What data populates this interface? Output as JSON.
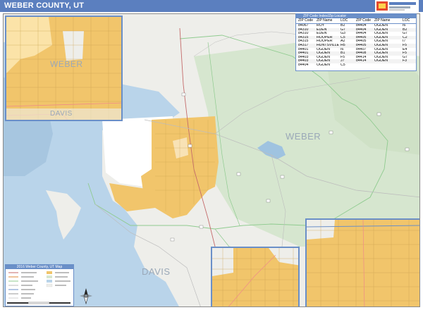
{
  "title": "WEBER COUNTY, UT",
  "logo": {
    "brand": "Market Maps",
    "icon": "market-maps-logo"
  },
  "map": {
    "labels": {
      "county_main": "WEBER",
      "davis_main": "DAVIS",
      "weber_inset": "WEBER",
      "davis_inset": "DAVIS"
    },
    "colors": {
      "water": "#b9d4ea",
      "lake_dark": "#a7c6e0",
      "land": "#eeeeea",
      "urban": "#f1c56b",
      "forest": "#d6e6cf",
      "boundary": "#8fcb8f",
      "road": "#d0d0d0",
      "frame": "#6a8fc8"
    }
  },
  "zip_table": {
    "title": "ZIP Code Index/Zip Locator",
    "headers": [
      "ZIP Code",
      "ZIP Name",
      "LOC",
      "ZIP Code",
      "ZIP Name",
      "LOC"
    ],
    "left_rows": [
      [
        "84067",
        "ROY",
        "B2"
      ],
      [
        "84310",
        "EDEN",
        "G7"
      ],
      [
        "84310",
        "EDEN",
        "G3"
      ],
      [
        "84315",
        "HOOPER",
        "C5"
      ],
      [
        "84315",
        "HOOPER",
        "A2"
      ],
      [
        "84317",
        "HUNTSVILLE",
        "H5"
      ],
      [
        "84401",
        "OGDEN",
        "I6"
      ],
      [
        "84401",
        "OGDEN",
        "B1"
      ],
      [
        "84403",
        "OGDEN",
        "F5"
      ],
      [
        "84403",
        "OGDEN",
        "J7"
      ],
      [
        "84404",
        "OGDEN",
        "C5"
      ]
    ],
    "right_rows": [
      [
        "84404",
        "OGDEN",
        "I6"
      ],
      [
        "84404",
        "OGDEN",
        "B2"
      ],
      [
        "84404",
        "OGDEN",
        "G7"
      ],
      [
        "84405",
        "OGDEN",
        "C2"
      ],
      [
        "84405",
        "OGDEN",
        "I7"
      ],
      [
        "84405",
        "OGDEN",
        "F5"
      ],
      [
        "84407",
        "OGDEN",
        "E4"
      ],
      [
        "84408",
        "OGDEN",
        "F5"
      ],
      [
        "84414",
        "OGDEN",
        "G7"
      ],
      [
        "84414",
        "OGDEN",
        "F3"
      ]
    ]
  },
  "legend": {
    "title": "2016 Weber County, UT Map"
  }
}
